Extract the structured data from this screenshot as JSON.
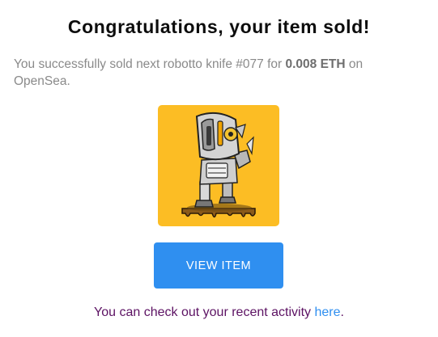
{
  "email": {
    "headline": "Congratulations, your item sold!",
    "message": {
      "prefix": "You successfully sold next robotto knife #077 for ",
      "price": "0.008 ETH",
      "suffix": " on OpenSea."
    },
    "nft_image": {
      "icon": "robot-knife-nft-image",
      "background_color": "#fcbd24"
    },
    "view_button_label": "VIEW ITEM",
    "activity": {
      "prefix": "You can check out your recent activity ",
      "link_text": "here",
      "suffix": "."
    }
  },
  "colors": {
    "button": "#2f8ff0",
    "link": "#2f8ff0",
    "activity_text": "#5c1263",
    "body_text": "#8a8a8a"
  }
}
